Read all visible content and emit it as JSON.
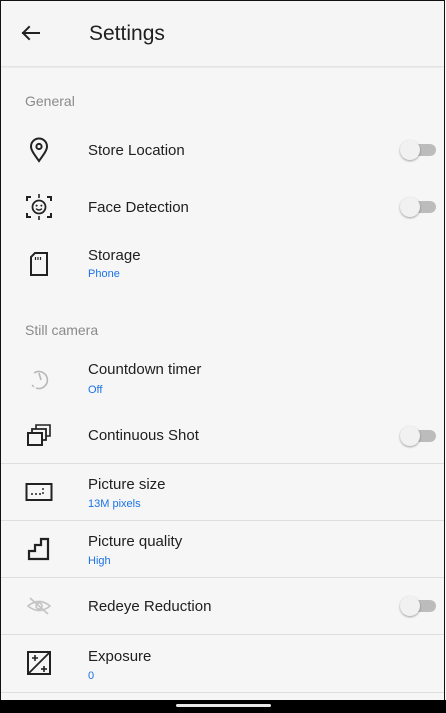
{
  "header": {
    "title": "Settings",
    "back_icon": "arrow-left-icon"
  },
  "sections": {
    "general": "General",
    "still_camera": "Still camera"
  },
  "settings": {
    "store_location": {
      "label": "Store Location",
      "icon": "location-pin-icon",
      "enabled": false
    },
    "face_detection": {
      "label": "Face Detection",
      "icon": "face-detection-icon",
      "enabled": false
    },
    "storage": {
      "label": "Storage",
      "value": "Phone",
      "icon": "sd-card-icon"
    },
    "countdown_timer": {
      "label": "Countdown timer",
      "value": "Off",
      "icon": "timer-icon"
    },
    "continuous_shot": {
      "label": "Continuous Shot",
      "icon": "burst-icon",
      "enabled": false
    },
    "picture_size": {
      "label": "Picture size",
      "value": "13M pixels",
      "icon": "picture-size-icon"
    },
    "picture_quality": {
      "label": "Picture quality",
      "value": "High",
      "icon": "quality-steps-icon"
    },
    "redeye_reduction": {
      "label": "Redeye Reduction",
      "icon": "redeye-off-icon",
      "enabled": false
    },
    "exposure": {
      "label": "Exposure",
      "value": "0",
      "icon": "exposure-icon"
    }
  },
  "colors": {
    "accent": "#1a73e8",
    "background": "#f6f6f6",
    "switch_track_off": "#bcbcbc",
    "switch_thumb_off": "#f1f1f1"
  }
}
